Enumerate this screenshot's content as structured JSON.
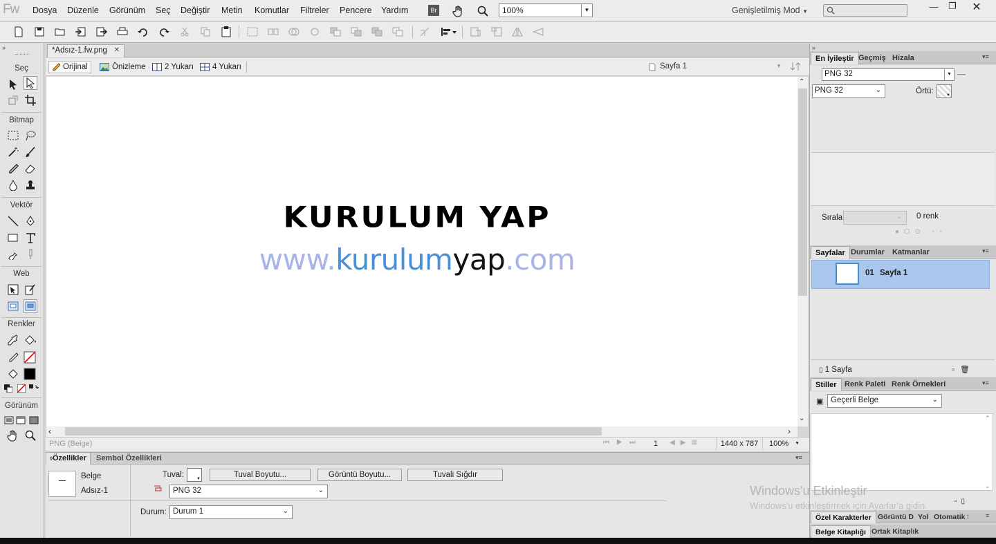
{
  "app": {
    "logo": "Fw"
  },
  "menu": [
    "Dosya",
    "Düzenle",
    "Görünüm",
    "Seç",
    "Değiştir",
    "Metin",
    "Komutlar",
    "Filtreler",
    "Pencere",
    "Yardım"
  ],
  "topbar": {
    "bridge_label": "Br",
    "zoom": "100%",
    "mode": "Genişletilmiş Mod"
  },
  "left_tools": {
    "sec": "Seç",
    "bitmap": "Bitmap",
    "vektor": "Vektör",
    "web": "Web",
    "renkler": "Renkler",
    "gorunum": "Görünüm"
  },
  "document": {
    "tab": "*Adsız-1.fw.png",
    "views": [
      "Orijinal",
      "Önizleme",
      "2 Yukarı",
      "4 Yukarı"
    ],
    "page_select": "Sayfa 1",
    "canvas_text": {
      "title": "KURULUM YAP",
      "url_www": "www.",
      "url_kurulum": "kurulum",
      "url_yap": "yap",
      "url_com": ".com"
    },
    "status": {
      "format": "PNG (Belge)",
      "page_no": "1",
      "size": "1440 x 787",
      "zoom": "100%"
    }
  },
  "properties": {
    "tabs": [
      "Özellikler",
      "Sembol Özellikleri"
    ],
    "doc_type": "Belge",
    "doc_name": "Adsız-1",
    "canvas_label": "Tuval:",
    "buttons": [
      "Tuval Boyutu...",
      "Görüntü Boyutu...",
      "Tuvali Sığdır"
    ],
    "format": "PNG 32",
    "state_label": "Durum:",
    "state_value": "Durum 1"
  },
  "right": {
    "opt_tabs": [
      "En İyileştir",
      "Geçmiş",
      "Hizala"
    ],
    "preset": "PNG 32",
    "format": "PNG 32",
    "matte_label": "Örtü:",
    "sort_label": "Sırala:",
    "color_count": "0 renk",
    "pages_tabs": [
      "Sayfalar",
      "Durumlar",
      "Katmanlar"
    ],
    "page_item_num": "01",
    "page_item_name": "Sayfa 1",
    "pages_count": "1 Sayfa",
    "styles_tabs": [
      "Stiller",
      "Renk Paleti",
      "Renk Örnekleri"
    ],
    "styles_select": "Geçerli Belge",
    "bottom_tabs": [
      "Özel Karakterler",
      "Görüntü D",
      "Yol",
      "Otomatik Ş"
    ],
    "library_tabs": [
      "Belge Kitaplığı",
      "Ortak Kitaplık"
    ]
  },
  "watermark": {
    "line1": "Windows'u Etkinleştir",
    "line2": "Windows'u etkinleştirmek için Ayarlar'a gidin."
  },
  "colors": {
    "accent_blue": "#4a90d9",
    "light_blue": "#a8b4e8",
    "selection": "#a9c6ec"
  }
}
